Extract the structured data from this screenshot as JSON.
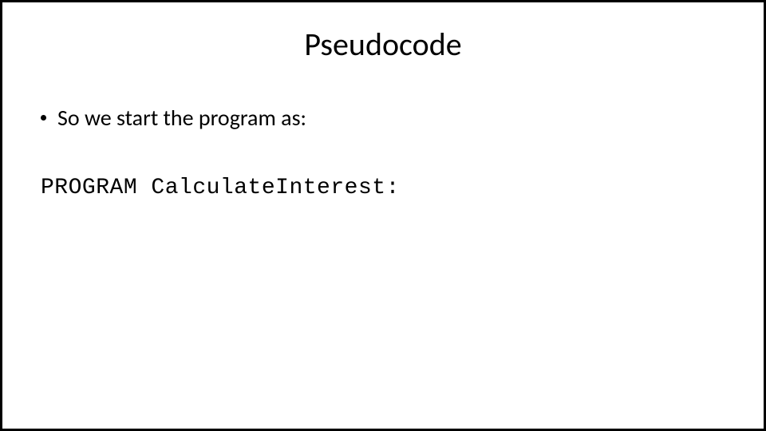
{
  "slide": {
    "title": "Pseudocode",
    "bullet_text": "So we start the program as:",
    "code_line": "PROGRAM CalculateInterest:"
  }
}
